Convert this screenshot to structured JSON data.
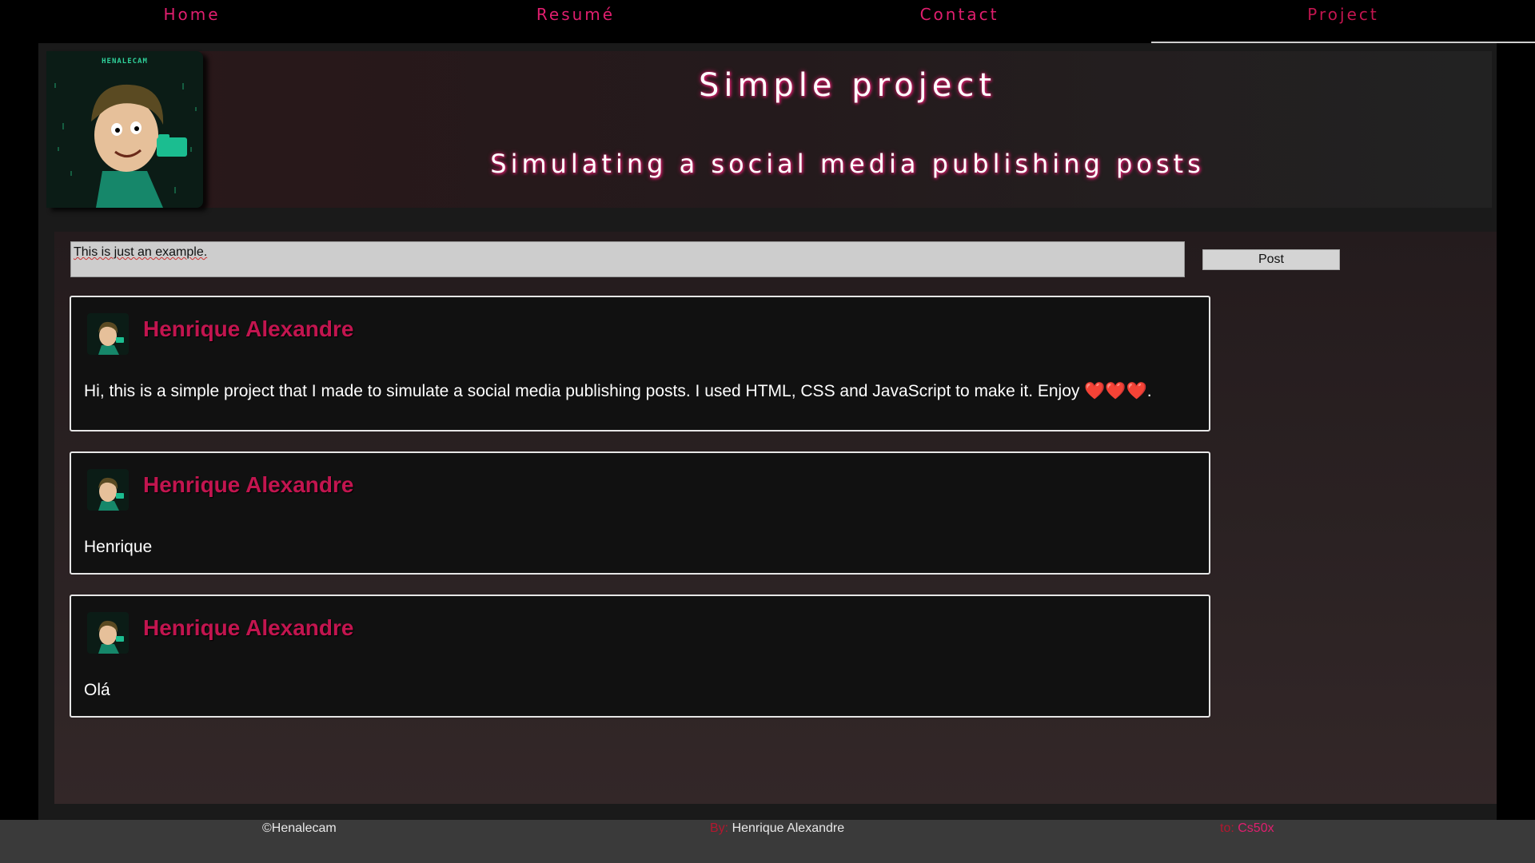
{
  "nav": {
    "items": [
      {
        "label": "Home"
      },
      {
        "label": "Resumé"
      },
      {
        "label": "Contact"
      },
      {
        "label": "Project"
      }
    ],
    "active": "Project"
  },
  "header": {
    "logo_text": "HENALECAM",
    "title": "Simple project",
    "subtitle": "Simulating a social media publishing posts"
  },
  "composer": {
    "value": "This is just an example.",
    "button_label": "Post"
  },
  "posts": [
    {
      "author": "Henrique Alexandre",
      "text": "Hi, this is a simple project that I made to simulate a social media publishing posts. I used HTML, CSS and JavaScript to make it. Enjoy ",
      "hearts": "❤️❤️❤️",
      "trail": "."
    },
    {
      "author": "Henrique Alexandre",
      "text": "Henrique"
    },
    {
      "author": "Henrique Alexandre",
      "text": "Olá"
    }
  ],
  "footer": {
    "copyright": "©Henalecam",
    "by_label": "By:",
    "by_name": "Henrique Alexandre",
    "to_label": "to:",
    "to_name": "Cs50x"
  },
  "colors": {
    "accent": "#e01e6e",
    "author": "#c2154f",
    "background": "#000000"
  }
}
